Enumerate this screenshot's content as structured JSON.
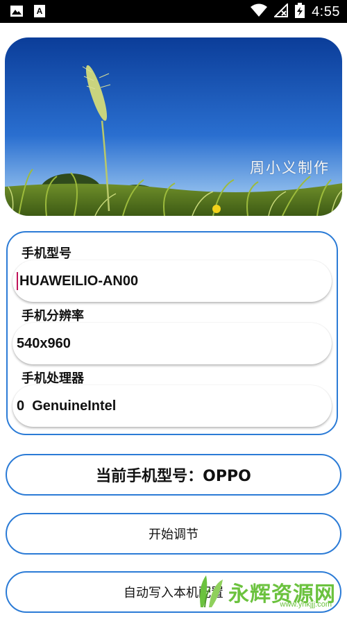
{
  "status_bar": {
    "time": "4:55",
    "left_icons": [
      "image-icon",
      "font-a-icon"
    ],
    "right_icons": [
      "wifi-icon",
      "no-signal-icon",
      "battery-charging-icon"
    ]
  },
  "banner": {
    "caption": "周小义制作"
  },
  "form": {
    "model_label": "手机型号",
    "model_value": "HUAWEILIO-AN00",
    "resolution_label": "手机分辨率",
    "resolution_value": "540x960",
    "cpu_label": "手机处理器",
    "cpu_value": "0  GenuineIntel"
  },
  "current_model": {
    "text": "当前手机型号：OPPO"
  },
  "buttons": {
    "start_label": "开始调节",
    "write_label": "自动写入本机配置"
  },
  "watermark": {
    "text": "永辉资源网",
    "url": "www.yhkjjj.com"
  },
  "colors": {
    "accent_border": "#2b7bd6",
    "caret": "#c0145a",
    "watermark": "#6bc23e"
  }
}
